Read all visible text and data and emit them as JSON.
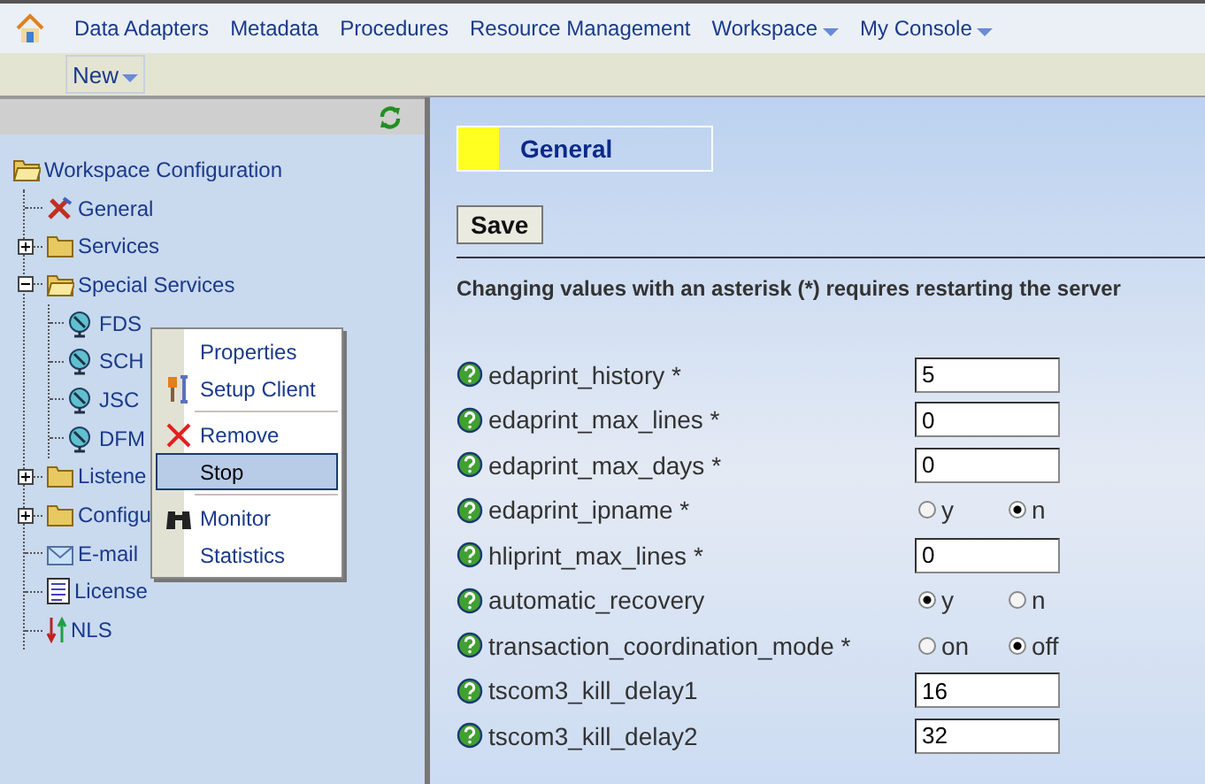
{
  "nav": {
    "items": [
      {
        "label": "Data Adapters",
        "dropdown": false
      },
      {
        "label": "Metadata",
        "dropdown": false
      },
      {
        "label": "Procedures",
        "dropdown": false
      },
      {
        "label": "Resource Management",
        "dropdown": false
      },
      {
        "label": "Workspace",
        "dropdown": true
      },
      {
        "label": "My Console",
        "dropdown": true
      }
    ]
  },
  "toolbar": {
    "items": [
      {
        "label": "New",
        "dropdown": true
      }
    ]
  },
  "tree": [
    {
      "label": "Workspace Configuration",
      "kind": "folder",
      "expanded": true,
      "children": [
        {
          "label": "General",
          "kind": "tools"
        },
        {
          "label": "Services",
          "kind": "folder",
          "expanded": false
        },
        {
          "label": "Special Services",
          "kind": "folder",
          "expanded": true,
          "children": [
            {
              "label": "FDS",
              "kind": "service"
            },
            {
              "label": "SCH",
              "kind": "service"
            },
            {
              "label": "JSC",
              "kind": "service"
            },
            {
              "label": "DFM",
              "kind": "service"
            }
          ]
        },
        {
          "label": "Listene",
          "kind": "folder",
          "expanded": false
        },
        {
          "label": "Configu",
          "kind": "folder",
          "expanded": false
        },
        {
          "label": "E-mail",
          "kind": "mail"
        },
        {
          "label": "License",
          "kind": "document"
        },
        {
          "label": "NLS",
          "kind": "language"
        }
      ]
    }
  ],
  "context_menu": {
    "groups": [
      [
        {
          "label": "Properties",
          "kind": "plain",
          "selected": false
        },
        {
          "label": "Setup Client",
          "kind": "setup",
          "selected": false
        }
      ],
      [
        {
          "label": "Remove",
          "kind": "remove",
          "selected": false
        },
        {
          "label": "Stop",
          "kind": "plain",
          "selected": true
        }
      ],
      [
        {
          "label": "Monitor",
          "kind": "monitor",
          "selected": false
        },
        {
          "label": "Statistics",
          "kind": "plain",
          "selected": false
        }
      ]
    ]
  },
  "panel": {
    "title": "General",
    "save_button": "Save",
    "notice": "Changing values with an asterisk (*) requires restarting the server",
    "settings": [
      {
        "label": "edaprint_history *",
        "kind": "text",
        "value": "5"
      },
      {
        "label": "edaprint_max_lines *",
        "kind": "text",
        "value": "0"
      },
      {
        "label": "edaprint_max_days *",
        "kind": "text",
        "value": "0"
      },
      {
        "label": "edaprint_ipname *",
        "kind": "radio",
        "options": [
          {
            "label": "y",
            "selected": false
          },
          {
            "label": "n",
            "selected": true
          }
        ]
      },
      {
        "label": "hliprint_max_lines *",
        "kind": "text",
        "value": "0"
      },
      {
        "label": "automatic_recovery",
        "kind": "radio",
        "options": [
          {
            "label": "y",
            "selected": true
          },
          {
            "label": "n",
            "selected": false
          }
        ]
      },
      {
        "label": "transaction_coordination_mode *",
        "kind": "radio",
        "options": [
          {
            "label": "on",
            "selected": false
          },
          {
            "label": "off",
            "selected": true
          }
        ]
      },
      {
        "label": "tscom3_kill_delay1",
        "kind": "text",
        "value": "16"
      },
      {
        "label": "tscom3_kill_delay2",
        "kind": "text",
        "value": "32"
      }
    ]
  }
}
